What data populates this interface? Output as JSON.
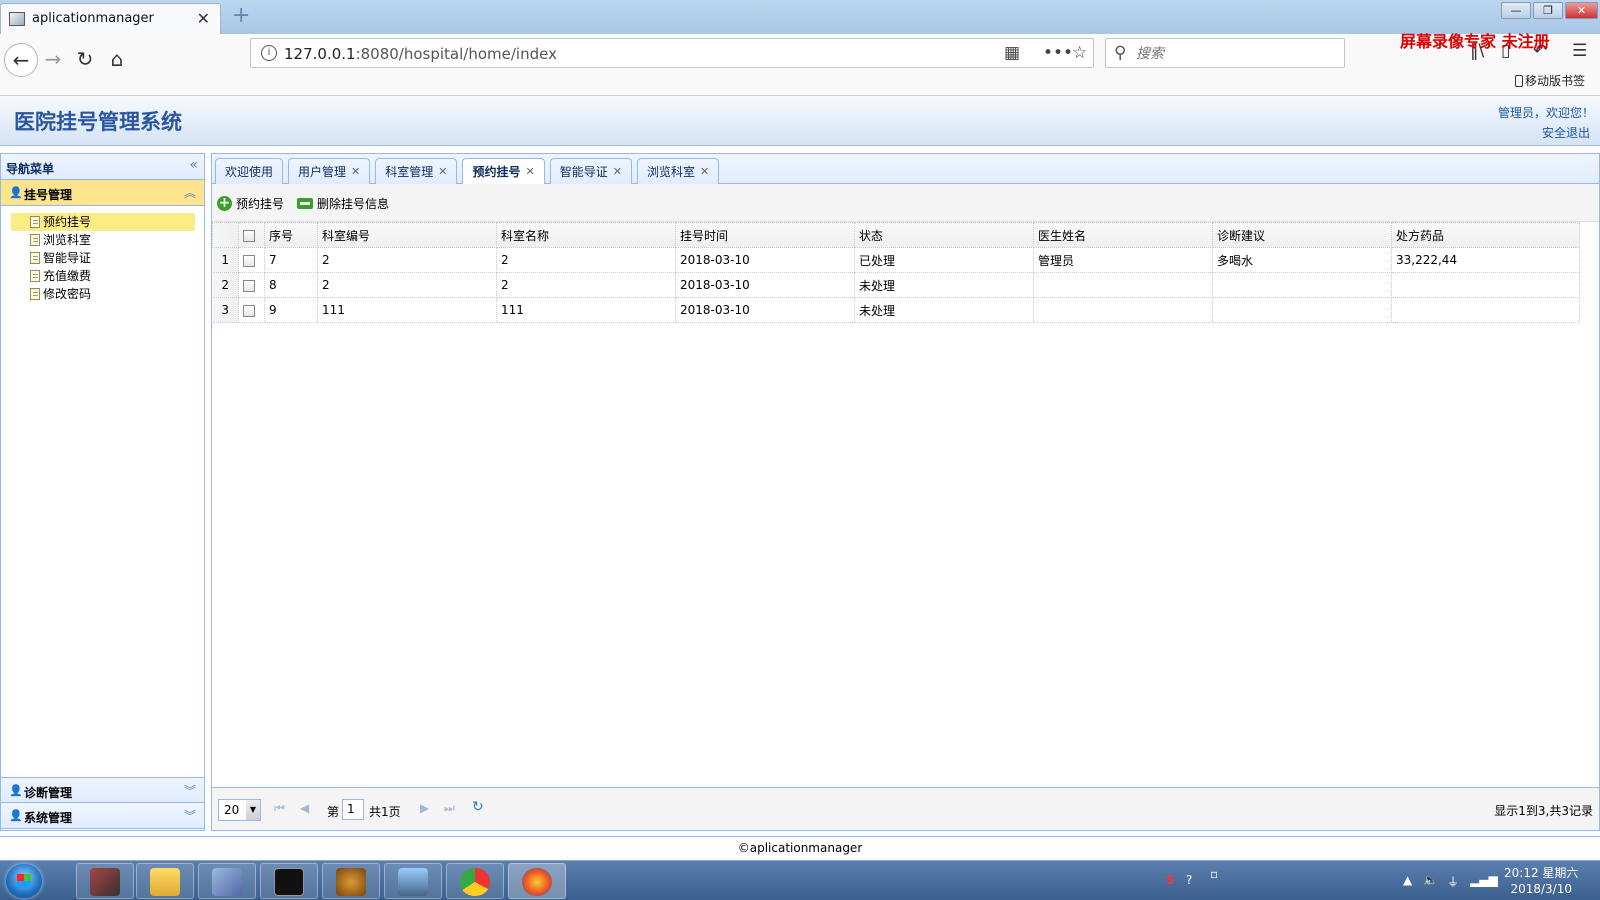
{
  "browser": {
    "tab_title": "aplicationmanager",
    "url_host": "127.0.0.1",
    "url_rest": ":8080/hospital/home/index",
    "search_placeholder": "搜索",
    "mobile_bookmarks": "移动版书签",
    "watermark": "屏幕录像专家 未注册"
  },
  "app": {
    "title": "医院挂号管理系统",
    "welcome": "管理员，欢迎您！",
    "logout": "安全退出",
    "footer": "©aplicationmanager"
  },
  "nav": {
    "header": "导航菜单",
    "groups": [
      {
        "label": "挂号管理",
        "icon": "user-icon"
      },
      {
        "label": "诊断管理",
        "icon": "user-icon"
      },
      {
        "label": "系统管理",
        "icon": "user-icon"
      }
    ],
    "items": [
      "预约挂号",
      "浏览科室",
      "智能导证",
      "充值缴费",
      "修改密码"
    ],
    "selected_item": "预约挂号"
  },
  "tabs": [
    {
      "label": "欢迎使用",
      "closable": false
    },
    {
      "label": "用户管理",
      "closable": true
    },
    {
      "label": "科室管理",
      "closable": true
    },
    {
      "label": "预约挂号",
      "closable": true
    },
    {
      "label": "智能导证",
      "closable": true
    },
    {
      "label": "浏览科室",
      "closable": true
    }
  ],
  "active_tab": "预约挂号",
  "toolbar": {
    "add_label": "预约挂号",
    "delete_label": "删除挂号信息"
  },
  "grid": {
    "columns": [
      "序号",
      "科室编号",
      "科室名称",
      "挂号时间",
      "状态",
      "医生姓名",
      "诊断建议",
      "处方药品"
    ],
    "rows": [
      {
        "rownum": "1",
        "cells": [
          "7",
          "2",
          "2",
          "2018-03-10",
          "已处理",
          "管理员",
          "多喝水",
          "33,222,44"
        ]
      },
      {
        "rownum": "2",
        "cells": [
          "8",
          "2",
          "2",
          "2018-03-10",
          "未处理",
          "",
          "",
          ""
        ]
      },
      {
        "rownum": "3",
        "cells": [
          "9",
          "111",
          "111",
          "2018-03-10",
          "未处理",
          "",
          "",
          ""
        ]
      }
    ]
  },
  "pager": {
    "page_size": "20",
    "page_prefix": "第",
    "page_number": "1",
    "page_total": "共1页",
    "info": "显示1到3,共3记录"
  },
  "taskbar": {
    "time": "20:12 星期六",
    "date": "2018/3/10"
  },
  "colors": {
    "accent": "#2a56a0",
    "panel_border": "#95b8e7",
    "selected": "#fbec88",
    "watermark": "#e00000"
  }
}
